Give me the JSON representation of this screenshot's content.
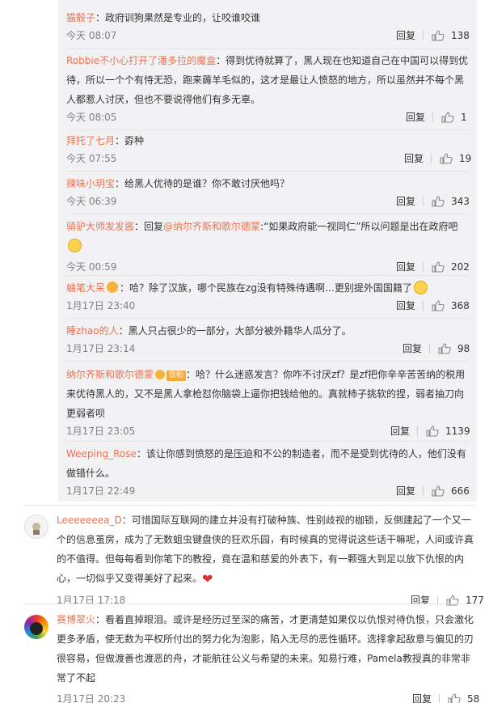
{
  "replies": [
    {
      "user": "猫骰子",
      "text": "：政府训狗果然是专业的，让咬谁咬谁",
      "time": "今天 08:07",
      "reply": "回复",
      "likes": "138"
    },
    {
      "user": "Robbie不小心打开了潘多拉的魔盒",
      "text": "：得到优待就算了，黑人现在也知道自己在中国可以得到优待，所以一个个有恃无恐，跑来薅羊毛似的，这才是最让人愤怒的地方，所以虽然并不每个黑人都惹人讨厌，但也不要说得他们有多无辜。",
      "time": "今天 08:05",
      "reply": "回复",
      "likes": "1"
    },
    {
      "user": "拜托了七月",
      "text": "：孬种",
      "time": "今天 07:55",
      "reply": "回复",
      "likes": "19"
    },
    {
      "user": "辣味小玥宝",
      "text": "：给黑人优待的是谁？你不敢讨厌他吗？",
      "time": "今天 06:39",
      "reply": "回复",
      "likes": "343"
    },
    {
      "user": "骑驴大师发发酱",
      "text": "：回复",
      "mention": "@纳尔齐斯和歌尔德蒙",
      "text2": ":“如果政府能一视同仁”所以问题是出在政府吧",
      "time": "今天 00:59",
      "reply": "回复",
      "likes": "202"
    },
    {
      "user": "蛐笔大呆",
      "text": "：哈？除了汉族，哪个民族在zg没有特殊待遇啊…更别提外国国籍了",
      "time": "1月17日 23:40",
      "reply": "回复",
      "likes": "368"
    },
    {
      "user": "睡zhao的人",
      "text": "：黑人只占很少的一部分，大部分被外籍华人瓜分了。",
      "time": "1月17日 23:14",
      "reply": "回复",
      "likes": "98"
    },
    {
      "user": "纳尔齐斯和歌尔德蒙",
      "tag": "铁粉",
      "text": "：哈？什么迷惑发言？你咋不讨厌zf？是zf把你辛辛苦苦纳的税用来优待黑人的，又不是黑人拿枪怼你脑袋上逼你把钱给他的。真就柿子挑软的捏，弱者抽刀向更弱者呗",
      "time": "1月17日 23:05",
      "reply": "回复",
      "likes": "1139"
    },
    {
      "user": "Weeping_Rose",
      "text": "：该让你感到愤怒的是压迫和不公的制造者，而不是受到优待的人，他们没有做错什么。",
      "time": "1月17日 22:49",
      "reply": "回复",
      "likes": "666"
    }
  ],
  "comments": [
    {
      "user": "Leeeeeeea_D",
      "text": "：可惜国际互联网的建立并没有打破种族、性别歧视的枷锁，反倒建起了一个又一个的信息茧房，成为了无数蛆虫键盘侠的狂欢乐园，有时候真的觉得说这些话干嘛呢，人间或许真的不值得。但每每看到你笔下的教授，竟在温和慈爱的外表下，有一颗强大到足以放下仇恨的内心，一切似乎又变得美好了起来。",
      "time": "1月17日 17:18",
      "reply": "回复",
      "likes": "177"
    },
    {
      "user": "赛博翠火",
      "text": "：看着直掉眼泪。或许是经历过至深的痛苦，才更清楚如果仅以仇恨对待仇恨，只会激化更多矛盾，使无数为平权所付出的努力化为泡影，陷入无尽的恶性循环。选择拿起敌意与偏见的刃很容易，但做渡善也渡恶的舟，才能航往公义与希望的未来。知易行难，Pamela教授真的非常非常了不起",
      "time": "1月17日 20:23",
      "reply": "回复",
      "likes": "58"
    }
  ],
  "colors": {
    "username": "#eb7350",
    "panel": "#f2f2f5",
    "text": "#333333",
    "meta": "#808080"
  },
  "icons": {
    "like": "thumbs-up-icon",
    "heart": "red-heart-emoji"
  }
}
